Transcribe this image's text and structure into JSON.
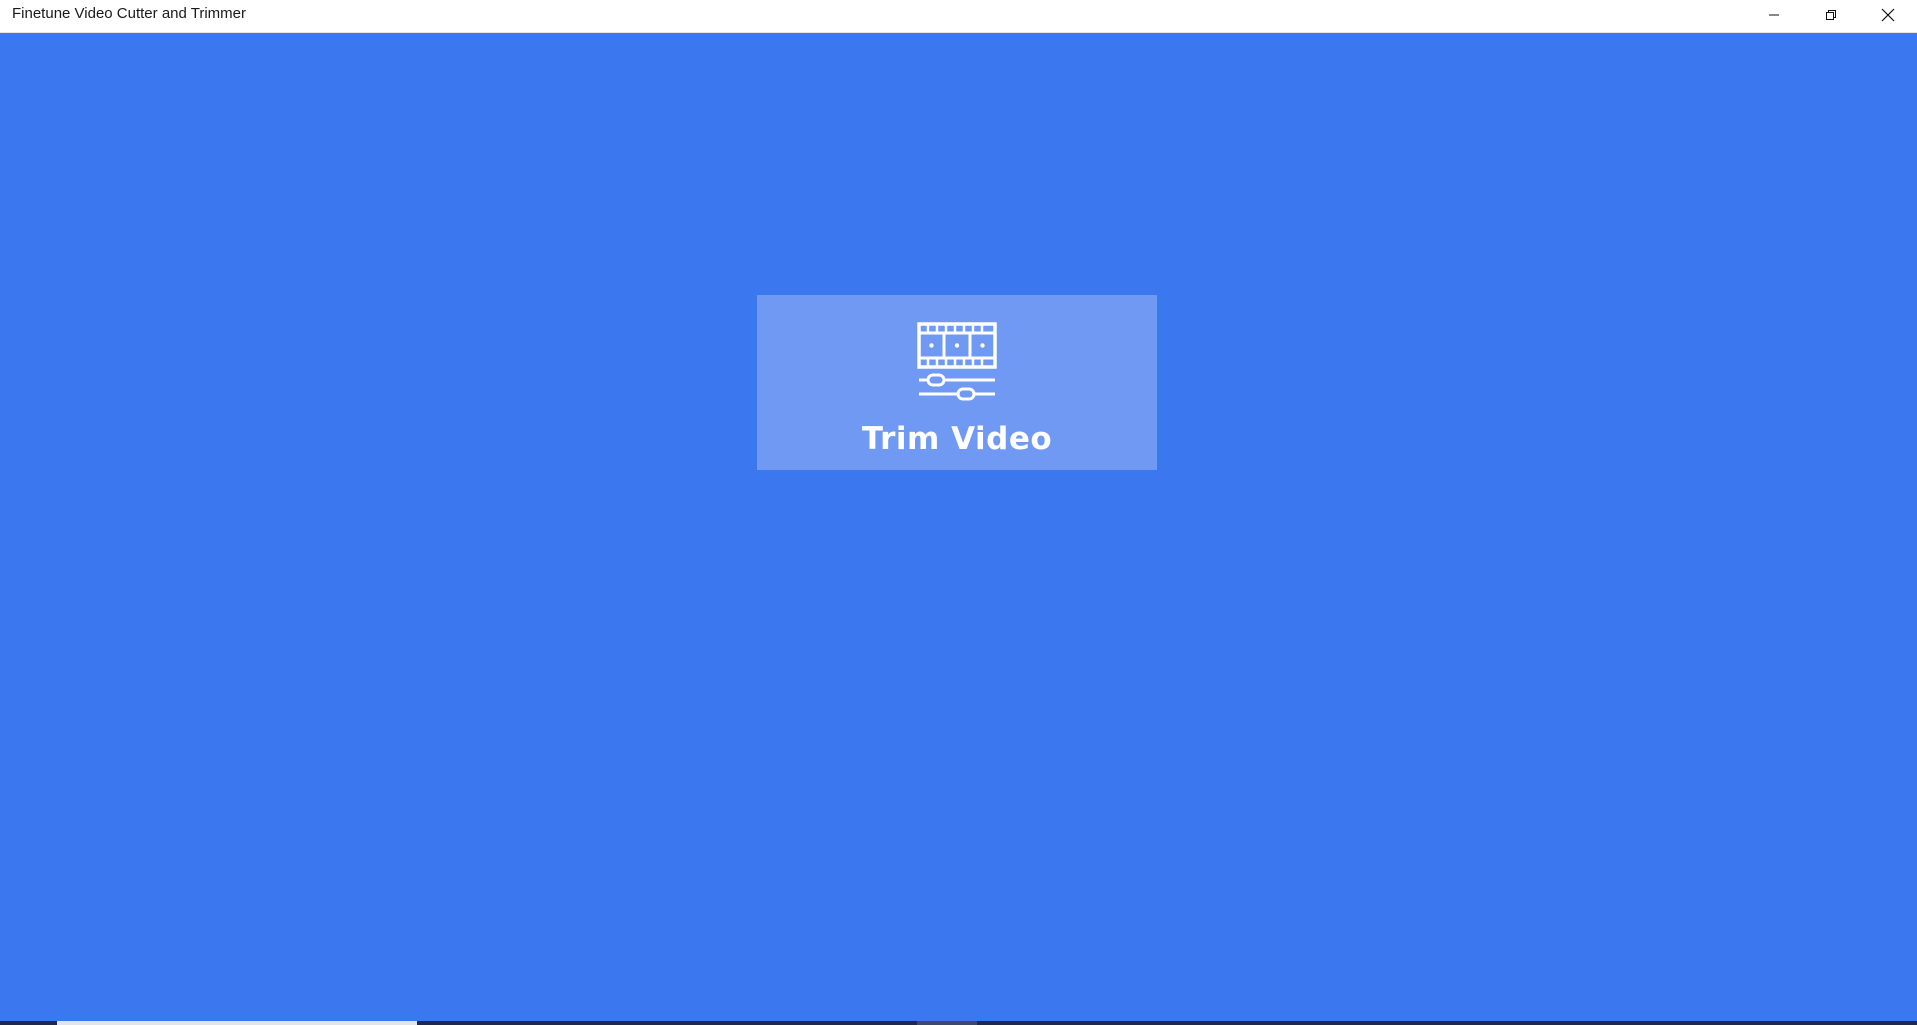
{
  "window": {
    "title": "Finetune Video Cutter and Trimmer",
    "controls": {
      "minimize_icon": "minimize-icon",
      "maximize_icon": "restore-icon",
      "close_icon": "close-icon"
    }
  },
  "main": {
    "background_color": "#3b77ee",
    "tile": {
      "label": "Trim Video",
      "icon": "film-trim-icon",
      "background_color": "#6f99f2"
    }
  }
}
